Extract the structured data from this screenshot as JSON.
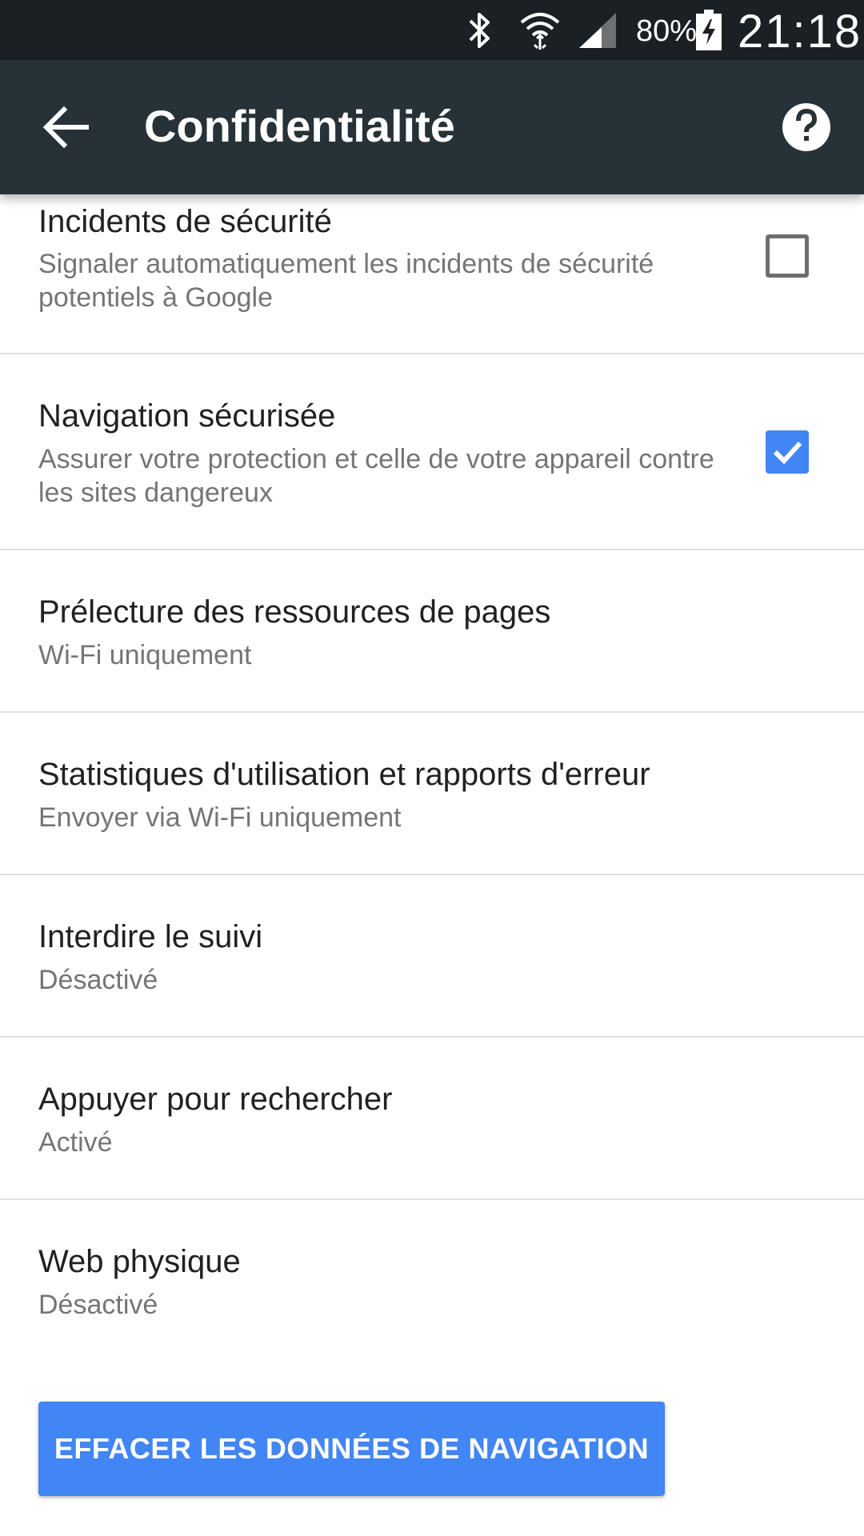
{
  "status_bar": {
    "battery_percent": "80%",
    "time": "21:18",
    "icons": [
      "bluetooth-icon",
      "wifi-icon",
      "signal-icon",
      "battery-charging-icon"
    ]
  },
  "app_bar": {
    "title": "Confidentialité",
    "back_icon": "arrow-back-icon",
    "help_icon": "help-icon"
  },
  "settings": [
    {
      "title": "Incidents de sécurité",
      "summary": "Signaler automatiquement les incidents de sécurité potentiels à Google",
      "checkbox": "unchecked"
    },
    {
      "title": "Navigation sécurisée",
      "summary": "Assurer votre protection et celle de votre appareil contre les sites dangereux",
      "checkbox": "checked"
    },
    {
      "title": "Prélecture des ressources de pages",
      "summary": "Wi-Fi uniquement"
    },
    {
      "title": "Statistiques d'utilisation et rapports d'erreur",
      "summary": "Envoyer via Wi-Fi uniquement"
    },
    {
      "title": "Interdire le suivi",
      "summary": "Désactivé"
    },
    {
      "title": "Appuyer pour rechercher",
      "summary": "Activé"
    },
    {
      "title": "Web physique",
      "summary": "Désactivé"
    }
  ],
  "clear_button": {
    "label": "EFFACER LES DONNÉES DE NAVIGATION"
  },
  "colors": {
    "status_bar": "#1b2025",
    "app_bar": "#263238",
    "accent": "#4285f4",
    "title_text": "#212121",
    "summary_text": "#757575",
    "divider": "#e0e0e0"
  }
}
